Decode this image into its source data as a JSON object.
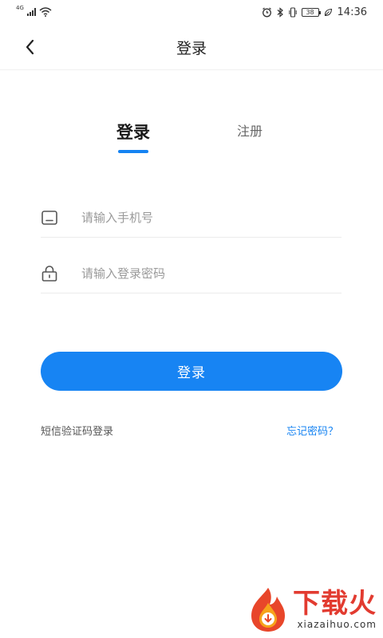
{
  "status_bar": {
    "network": "4G",
    "time": "14:36",
    "battery": "38"
  },
  "header": {
    "title": "登录",
    "back_icon": "chevron-left-icon"
  },
  "tabs": [
    {
      "label": "登录",
      "active": true
    },
    {
      "label": "注册",
      "active": false
    }
  ],
  "form": {
    "phone": {
      "placeholder": "请输入手机号",
      "value": "",
      "icon": "phone-icon"
    },
    "password": {
      "placeholder": "请输入登录密码",
      "value": "",
      "icon": "lock-icon"
    },
    "submit_label": "登录"
  },
  "links": {
    "sms_login": "短信验证码登录",
    "forgot_password": "忘记密码？"
  },
  "watermark": {
    "brand": "下载火",
    "domain": "xiazaihuo.com"
  },
  "colors": {
    "accent": "#1784f3",
    "watermark_red": "#e23b30"
  }
}
